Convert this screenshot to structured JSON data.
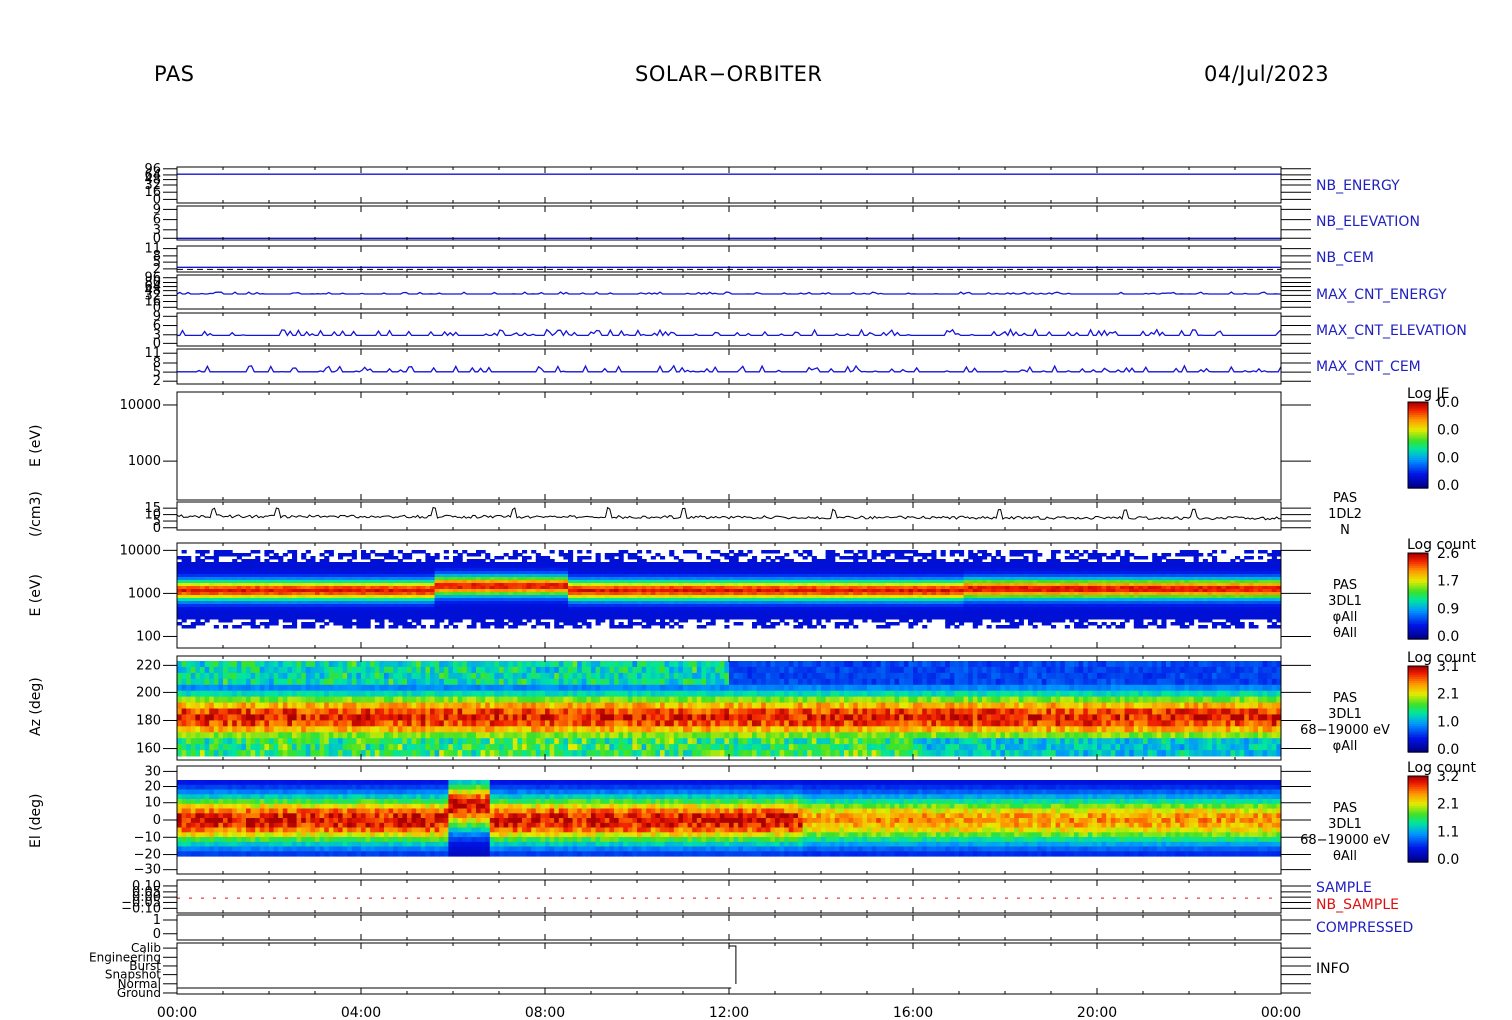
{
  "header": {
    "instrument": "PAS",
    "mission": "SOLAR−ORBITER",
    "date": "04/Jul/2023"
  },
  "colors": {
    "trace_blue": "#1414d8",
    "label_blue": "#2020c0",
    "label_red": "#e01010",
    "axis": "#000000"
  },
  "chart_data": {
    "type": "heatmap",
    "x_axis": {
      "ticks": [
        "00:00",
        "04:00",
        "08:00",
        "12:00",
        "16:00",
        "20:00",
        "00:00"
      ],
      "range_hours": [
        0,
        24
      ]
    },
    "panels": [
      {
        "id": "nb_energy",
        "label": "NB_ENERGY",
        "label_color": "blue",
        "type": "line",
        "ytick_labels": [
          "96",
          "64",
          "48",
          "32",
          "16",
          "0"
        ]
      },
      {
        "id": "nb_elevation",
        "label": "NB_ELEVATION",
        "label_color": "blue",
        "type": "line",
        "ytick_labels": [
          "9",
          "6",
          "3",
          "0"
        ]
      },
      {
        "id": "nb_cem",
        "label": "NB_CEM",
        "label_color": "blue",
        "type": "line",
        "ytick_labels": [
          "11",
          "8",
          "5",
          "2"
        ]
      },
      {
        "id": "max_cnt_energy",
        "label": "MAX_CNT_ENERGY",
        "label_color": "blue",
        "type": "line",
        "ytick_labels": [
          "96",
          "80",
          "64",
          "48",
          "32",
          "16",
          "0"
        ]
      },
      {
        "id": "max_cnt_elevation",
        "label": "MAX_CNT_ELEVATION",
        "label_color": "blue",
        "type": "line",
        "ytick_labels": [
          "9",
          "6",
          "3",
          "0"
        ]
      },
      {
        "id": "max_cnt_cem",
        "label": "MAX_CNT_CEM",
        "label_color": "blue",
        "type": "line",
        "ytick_labels": [
          "11",
          "8",
          "5",
          "2"
        ]
      },
      {
        "id": "je_spectrogram",
        "ylabel": "E (eV)",
        "type": "heatmap",
        "ylog": true,
        "ytick_labels": [
          "10000",
          "1000"
        ],
        "colorbar": {
          "title": "Log JE",
          "labels": [
            "0.0",
            "0.0",
            "0.0",
            "0.0"
          ]
        }
      },
      {
        "id": "density",
        "ylabel": "(/cm3)",
        "type": "line",
        "ytick_labels": [
          "15",
          "10",
          "5",
          "0"
        ],
        "annot": [
          "PAS",
          "1DL2",
          "N"
        ],
        "baseline_value": 5.5,
        "spikes_hours": [
          0.8,
          2.2,
          5.6,
          7.3,
          9.4,
          11.0,
          14.3,
          17.9,
          20.6,
          22.1
        ]
      },
      {
        "id": "energy_spectrogram",
        "ylabel": "E (eV)",
        "type": "heatmap",
        "ylog": true,
        "ytick_labels": [
          "10000",
          "1000",
          "100"
        ],
        "annot": [
          "PAS",
          "3DL1",
          "φAll",
          "θAll"
        ],
        "colorbar": {
          "title": "Log count",
          "labels": [
            "2.6",
            "1.7",
            "0.9",
            "0.0"
          ]
        }
      },
      {
        "id": "azimuth_spectrogram",
        "ylabel": "Az (deg)",
        "type": "heatmap",
        "ytick_labels": [
          "220",
          "200",
          "180",
          "160"
        ],
        "annot": [
          "PAS",
          "3DL1",
          "68−19000 eV",
          "φAll"
        ],
        "colorbar": {
          "title": "Log count",
          "labels": [
            "3.1",
            "2.1",
            "1.0",
            "0.0"
          ]
        }
      },
      {
        "id": "elevation_spectrogram",
        "ylabel": "El (deg)",
        "type": "heatmap",
        "ytick_labels": [
          "30",
          "20",
          "10",
          "0",
          "−10",
          "−20",
          "−30"
        ],
        "annot": [
          "PAS",
          "3DL1",
          "68−19000 eV",
          "θAll"
        ],
        "colorbar": {
          "title": "Log count",
          "labels": [
            "3.2",
            "2.1",
            "1.1",
            "0.0"
          ]
        }
      },
      {
        "id": "sample",
        "labels": [
          "SAMPLE",
          "NB_SAMPLE"
        ],
        "label_colors": [
          "blue",
          "red"
        ],
        "type": "line",
        "ytick_labels": [
          "0.10",
          "0.05",
          "0.00",
          "−0.05",
          "−0.10"
        ]
      },
      {
        "id": "compressed",
        "label": "COMPRESSED",
        "label_color": "blue",
        "type": "line",
        "ytick_labels": [
          "1",
          "0"
        ]
      },
      {
        "id": "info",
        "label": "INFO",
        "label_color": "black",
        "type": "line",
        "ytick_labels": [
          "Calib",
          "Engineering",
          "Burst",
          "Snapshot",
          "Normal",
          "Ground"
        ]
      }
    ]
  }
}
